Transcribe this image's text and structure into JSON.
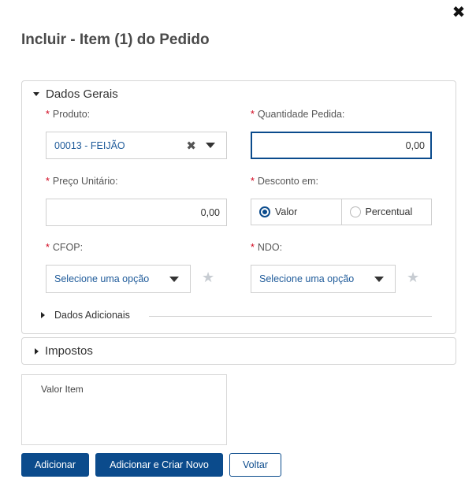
{
  "dialog": {
    "title": "Incluir - Item (1) do Pedido",
    "close_icon": "close-icon"
  },
  "dados_gerais": {
    "title": "Dados Gerais",
    "produto": {
      "label": "Produto:",
      "value": "00013 - FEIJÃO",
      "required_mark": "*"
    },
    "quantidade": {
      "label": "Quantidade Pedida:",
      "value": "0,00",
      "required_mark": "*"
    },
    "preco": {
      "label": "Preço Unitário:",
      "value": "0,00",
      "required_mark": "*"
    },
    "desconto": {
      "label": "Desconto em:",
      "required_mark": "*",
      "options": [
        {
          "label": "Valor",
          "selected": true
        },
        {
          "label": "Percentual",
          "selected": false
        }
      ]
    },
    "cfop": {
      "label": "CFOP:",
      "placeholder": "Selecione uma opção",
      "required_mark": "*"
    },
    "ndo": {
      "label": "NDO:",
      "placeholder": "Selecione uma opção",
      "required_mark": "*"
    },
    "dados_adicionais": {
      "title": "Dados Adicionais"
    }
  },
  "impostos": {
    "title": "Impostos"
  },
  "valor_item": {
    "label": "Valor Item"
  },
  "actions": {
    "add": "Adicionar",
    "add_new": "Adicionar e Criar Novo",
    "back": "Voltar"
  },
  "colors": {
    "primary": "#0b4b8c",
    "required": "#d0021b",
    "link_text": "#1f5b9a"
  }
}
